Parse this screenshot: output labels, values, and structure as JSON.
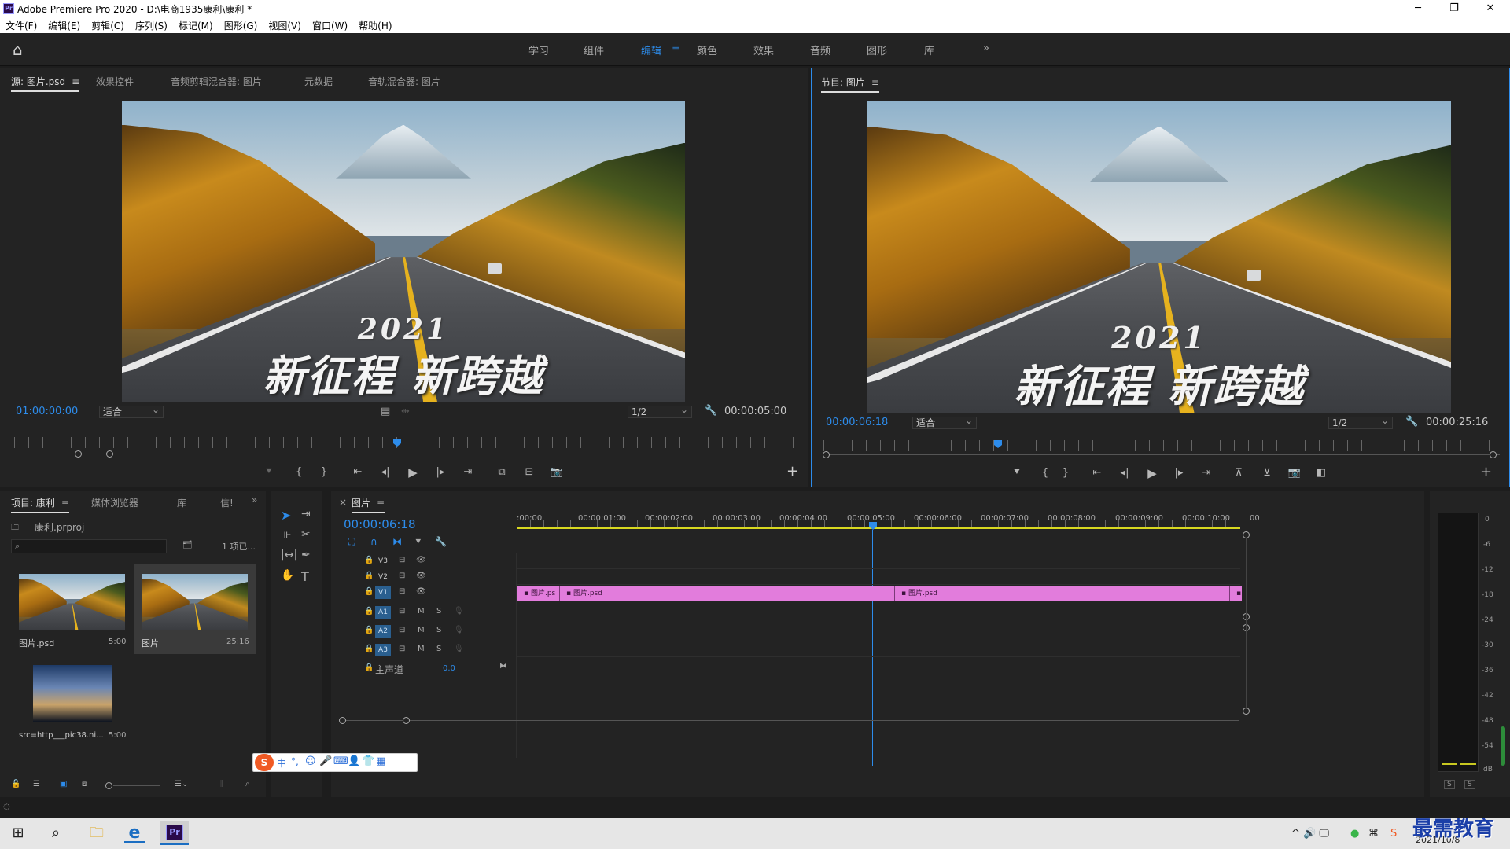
{
  "window": {
    "title": "Adobe Premiere Pro 2020 - D:\\电商1935康利\\康利 *",
    "app_icon": "Pr",
    "minimize": "─",
    "maximize": "❐",
    "close": "✕"
  },
  "menu": [
    "文件(F)",
    "编辑(E)",
    "剪辑(C)",
    "序列(S)",
    "标记(M)",
    "图形(G)",
    "视图(V)",
    "窗口(W)",
    "帮助(H)"
  ],
  "workspaces": {
    "items": [
      "学习",
      "组件",
      "编辑",
      "颜色",
      "效果",
      "音频",
      "图形",
      "库"
    ],
    "active": "编辑",
    "menu_icon": "≡",
    "more": "»"
  },
  "source": {
    "tabs": [
      "源: 图片.psd",
      "效果控件",
      "音频剪辑混合器: 图片",
      "元数据",
      "音轨混合器: 图片"
    ],
    "timecode": "01:00:00:00",
    "fit": "适合",
    "resolution": "1/2",
    "duration": "00:00:05:00",
    "overlay_year": "2021",
    "overlay_text": "新征程 新跨越"
  },
  "program": {
    "tab": "节目: 图片",
    "timecode": "00:00:06:18",
    "fit": "适合",
    "resolution": "1/2",
    "duration": "00:00:25:16",
    "overlay_year": "2021",
    "overlay_text": "新征程 新跨越"
  },
  "project": {
    "tabs": [
      "项目: 康利",
      "媒体浏览器",
      "库",
      "信!"
    ],
    "more": "»",
    "file": "康利.prproj",
    "count": "1 项已...",
    "items": [
      {
        "name": "图片.psd",
        "duration": "5:00"
      },
      {
        "name": "图片",
        "duration": "25:16"
      },
      {
        "name": "src=http___pic38.ni...",
        "duration": "5:00"
      }
    ]
  },
  "timeline": {
    "tab": "图片",
    "close": "×",
    "timecode": "00:00:06:18",
    "ruler": [
      ":00:00",
      "00:00:01:00",
      "00:00:02:00",
      "00:00:03:00",
      "00:00:04:00",
      "00:00:05:00",
      "00:00:06:00",
      "00:00:07:00",
      "00:00:08:00",
      "00:00:09:00",
      "00:00:10:00",
      "00"
    ],
    "video_tracks": [
      "V3",
      "V2",
      "V1"
    ],
    "audio_tracks": [
      "A1",
      "A2",
      "A3"
    ],
    "m": "M",
    "s": "S",
    "master": "主声道",
    "master_value": "0.0",
    "clips": [
      "图片.ps",
      "图片.psd",
      "图片.psd"
    ]
  },
  "meter": {
    "scale": [
      "0",
      "-6",
      "-12",
      "-18",
      "-24",
      "-30",
      "-36",
      "-42",
      "-48",
      "-54",
      "dB"
    ],
    "solo": [
      "S",
      "S"
    ]
  },
  "ime": {
    "label": "中",
    "punct": "°,"
  },
  "taskbar": {
    "date": "2021/10/8",
    "pr_icon": "Pr",
    "edge_icon": "e",
    "tray": "^ 🔊 🖵"
  },
  "watermark": "最需教育",
  "colors": {
    "accent": "#2d8ceb",
    "clip": "#e27cdc",
    "panel": "#232323"
  }
}
